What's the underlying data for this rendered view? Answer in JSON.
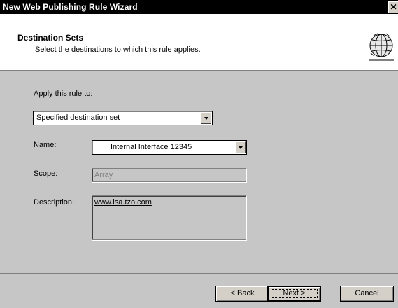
{
  "window": {
    "title": "New Web Publishing Rule Wizard",
    "close_glyph": "✕"
  },
  "header": {
    "title": "Destination Sets",
    "subtitle": "Select the destinations to which this rule applies.",
    "icon": "globe-icon"
  },
  "form": {
    "apply_label": "Apply this rule to:",
    "apply_value": "Specified destination set",
    "name_label": "Name:",
    "name_value": "Internal Interface 12345",
    "scope_label": "Scope:",
    "scope_value": "Array",
    "description_label": "Description:",
    "description_value": "www.isa.tzo.com"
  },
  "buttons": {
    "back": "< Back",
    "next": "Next >",
    "cancel": "Cancel"
  },
  "colors": {
    "titlebar": "#000000",
    "dialog_bg": "#c6c6c6",
    "header_bg": "#ffffff"
  }
}
